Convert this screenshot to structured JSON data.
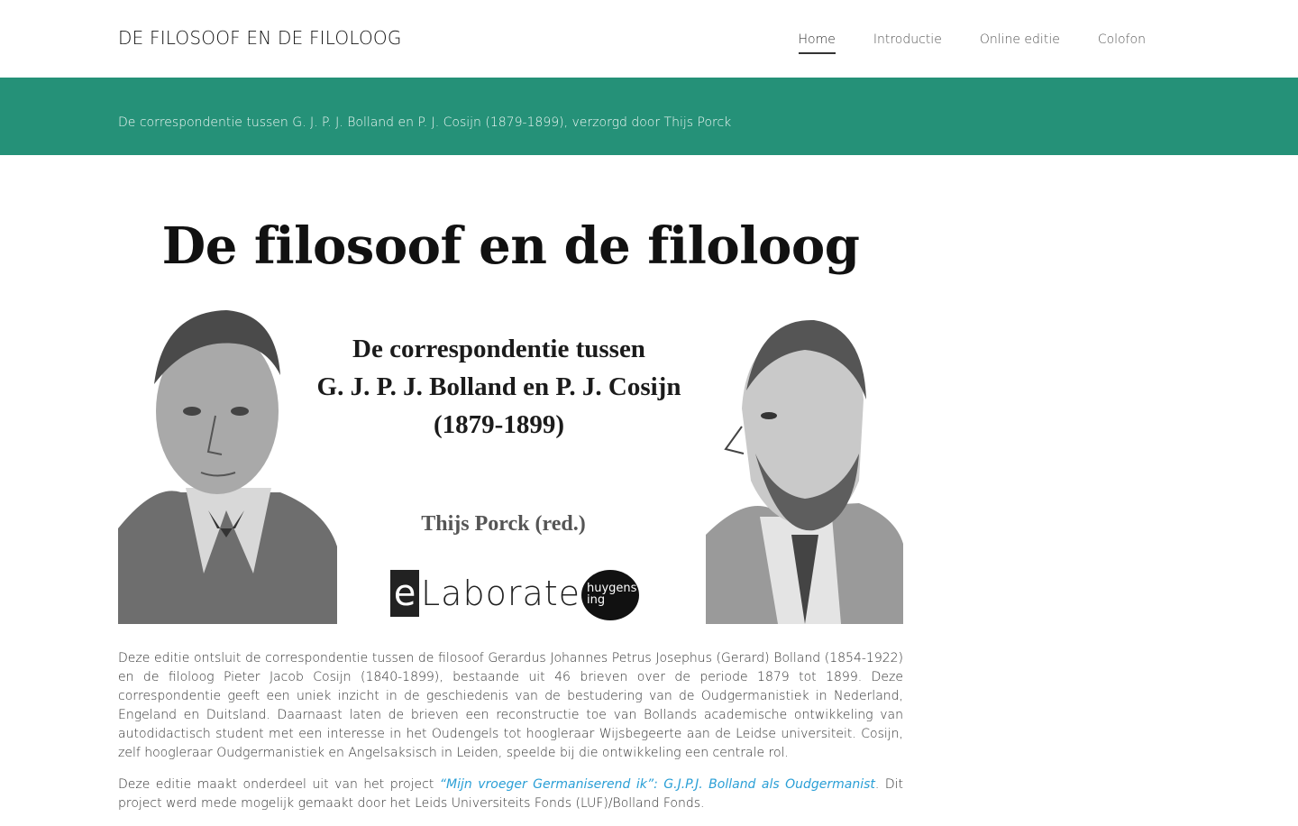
{
  "header": {
    "site_title": "DE FILOSOOF EN DE FILOLOOG",
    "nav": [
      {
        "label": "Home",
        "active": true
      },
      {
        "label": "Introductie"
      },
      {
        "label": "Online editie"
      },
      {
        "label": "Colofon"
      }
    ]
  },
  "banner": {
    "text": "De correspondentie tussen G. J. P. J. Bolland en P. J. Cosijn (1879-1899), verzorgd door Thijs Porck",
    "color": "#259178"
  },
  "cover": {
    "title": "De filosoof en de filoloog",
    "subtitle_line1": "De correspondentie tussen",
    "subtitle_line2": "G. J. P. J. Bolland en P. J. Cosijn",
    "subtitle_line3": "(1879-1899)",
    "editor": "Thijs Porck (red.)",
    "logo_elaborate_e": "e",
    "logo_elaborate_text": "Laborate",
    "logo_huygens_line1": "huygens",
    "logo_huygens_line2": "ing"
  },
  "content": {
    "para1": "Deze editie ontsluit de correspondentie tussen de filosoof Gerardus Johannes Petrus Josephus (Gerard) Bolland (1854-1922) en de filoloog Pieter Jacob Cosijn (1840-1899), bestaande uit 46 brieven over de periode 1879 tot 1899. Deze correspondentie geeft een uniek inzicht in de geschiedenis van de bestudering van de Oudgermanistiek in Nederland, Engeland en Duitsland. Daarnaast laten de brieven een reconstructie toe van Bollands academische ontwikkeling van autodidactisch student met een interesse in het Oudengels tot hoogleraar Wijsbegeerte aan de Leidse universiteit. Cosijn, zelf hoogleraar Oudgermanistiek en Angelsaksisch in Leiden, speelde bij die ontwikkeling een centrale rol.",
    "para2_before": "Deze editie maakt onderdeel uit van het project ",
    "para2_link": "“Mijn vroeger Germaniserend ik”: G.J.P.J. Bolland als Oudgermanist",
    "para2_after": ". Dit project werd mede mogelijk gemaakt door het Leids Universiteits Fonds (LUF)/Bolland Fonds."
  }
}
